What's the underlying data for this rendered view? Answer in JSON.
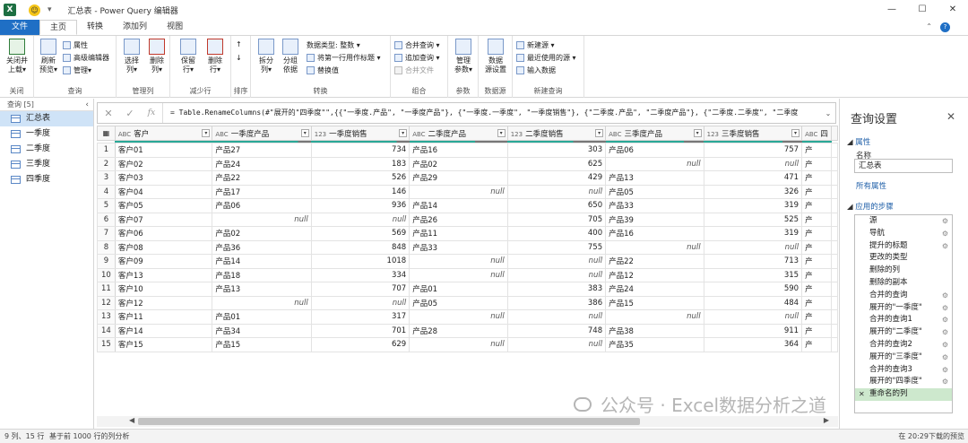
{
  "titlebar": {
    "title": "汇总表 - Power Query 编辑器",
    "logo": "X",
    "min": "—",
    "max": "☐",
    "close": "✕"
  },
  "tabs": [
    "文件",
    "主页",
    "转换",
    "添加列",
    "视图"
  ],
  "ribbon": {
    "groups": [
      "关闭",
      "查询",
      "管理列",
      "减少行",
      "排序",
      "转换",
      "组合",
      "参数",
      "数据源",
      "新建查询"
    ],
    "close_load": "关闭并\n上载▾",
    "refresh": "刷新\n预览▾",
    "properties": "属性",
    "advanced_editor": "高级编辑器",
    "manage": "管理▾",
    "choose_cols": "选择\n列▾",
    "remove_cols": "删除\n列▾",
    "keep_rows": "保留\n行▾",
    "remove_rows": "删除\n行▾",
    "split_col": "拆分\n列▾",
    "group_by": "分组\n依据",
    "data_type": "数据类型: 整数 ▾",
    "first_row_header": "将第一行用作标题 ▾",
    "replace_values": "替换值",
    "merge_queries": "合并查询 ▾",
    "append_queries": "追加查询 ▾",
    "combine_files": "合并文件",
    "manage_params": "管理\n参数▾",
    "ds_settings": "数据\n源设置",
    "new_source": "新建源 ▾",
    "recent_sources": "最近使用的源 ▾",
    "enter_data": "输入数据"
  },
  "queries": {
    "header": "查询 [5]",
    "items": [
      "汇总表",
      "一季度",
      "二季度",
      "三季度",
      "四季度"
    ]
  },
  "formula": "= Table.RenameColumns(#\"展开的\"四季度\"\",{{\"一季度.产品\", \"一季度产品\"}, {\"一季度.一季度\", \"一季度销售\"}, {\"二季度.产品\", \"二季度产品\"}, {\"二季度.二季度\", \"二季度",
  "columns": [
    {
      "type": "ABC",
      "name": "客户"
    },
    {
      "type": "ABC",
      "name": "一季度产品"
    },
    {
      "type": "123",
      "name": "一季度销售"
    },
    {
      "type": "ABC",
      "name": "二季度产品"
    },
    {
      "type": "123",
      "name": "二季度销售"
    },
    {
      "type": "ABC",
      "name": "三季度产品"
    },
    {
      "type": "123",
      "name": "三季度销售"
    },
    {
      "type": "ABC",
      "name": "四"
    }
  ],
  "rows": [
    [
      "客户01",
      "产品27",
      "734",
      "产品16",
      "303",
      "产品06",
      "757",
      "产"
    ],
    [
      "客户02",
      "产品24",
      "183",
      "产品02",
      "625",
      "null",
      "null",
      "产"
    ],
    [
      "客户03",
      "产品22",
      "526",
      "产品29",
      "429",
      "产品13",
      "471",
      "产"
    ],
    [
      "客户04",
      "产品17",
      "146",
      "null",
      "null",
      "产品05",
      "326",
      "产"
    ],
    [
      "客户05",
      "产品06",
      "936",
      "产品14",
      "650",
      "产品33",
      "319",
      "产"
    ],
    [
      "客户07",
      "null",
      "null",
      "产品26",
      "705",
      "产品39",
      "525",
      "产"
    ],
    [
      "客户06",
      "产品02",
      "569",
      "产品11",
      "400",
      "产品16",
      "319",
      "产"
    ],
    [
      "客户08",
      "产品36",
      "848",
      "产品33",
      "755",
      "null",
      "null",
      "产"
    ],
    [
      "客户09",
      "产品14",
      "1018",
      "null",
      "null",
      "产品22",
      "713",
      "产"
    ],
    [
      "客户13",
      "产品18",
      "334",
      "null",
      "null",
      "产品12",
      "315",
      "产"
    ],
    [
      "客户10",
      "产品13",
      "707",
      "产品01",
      "383",
      "产品24",
      "590",
      "产"
    ],
    [
      "客户12",
      "null",
      "null",
      "产品05",
      "386",
      "产品15",
      "484",
      "产"
    ],
    [
      "客户11",
      "产品01",
      "317",
      "null",
      "null",
      "null",
      "null",
      "产"
    ],
    [
      "客户14",
      "产品34",
      "701",
      "产品28",
      "748",
      "产品38",
      "911",
      "产"
    ],
    [
      "客户15",
      "产品15",
      "629",
      "null",
      "null",
      "产品35",
      "364",
      "产"
    ]
  ],
  "settings": {
    "title": "查询设置",
    "props_header": "属性",
    "name_label": "名称",
    "name_value": "汇总表",
    "all_props": "所有属性",
    "steps_header": "应用的步骤",
    "steps": [
      "源",
      "导航",
      "提升的标题",
      "更改的类型",
      "删除的列",
      "删除的副本",
      "合并的查询",
      "展开的\"一季度\"",
      "合并的查询1",
      "展开的\"二季度\"",
      "合并的查询2",
      "展开的\"三季度\"",
      "合并的查询3",
      "展开的\"四季度\"",
      "重命名的列"
    ]
  },
  "status": {
    "left": "9 列、15 行",
    "mid": "基于前 1000 行的列分析",
    "right": "在 20:29下载的预览"
  },
  "watermark": "公众号 · Excel数据分析之道"
}
